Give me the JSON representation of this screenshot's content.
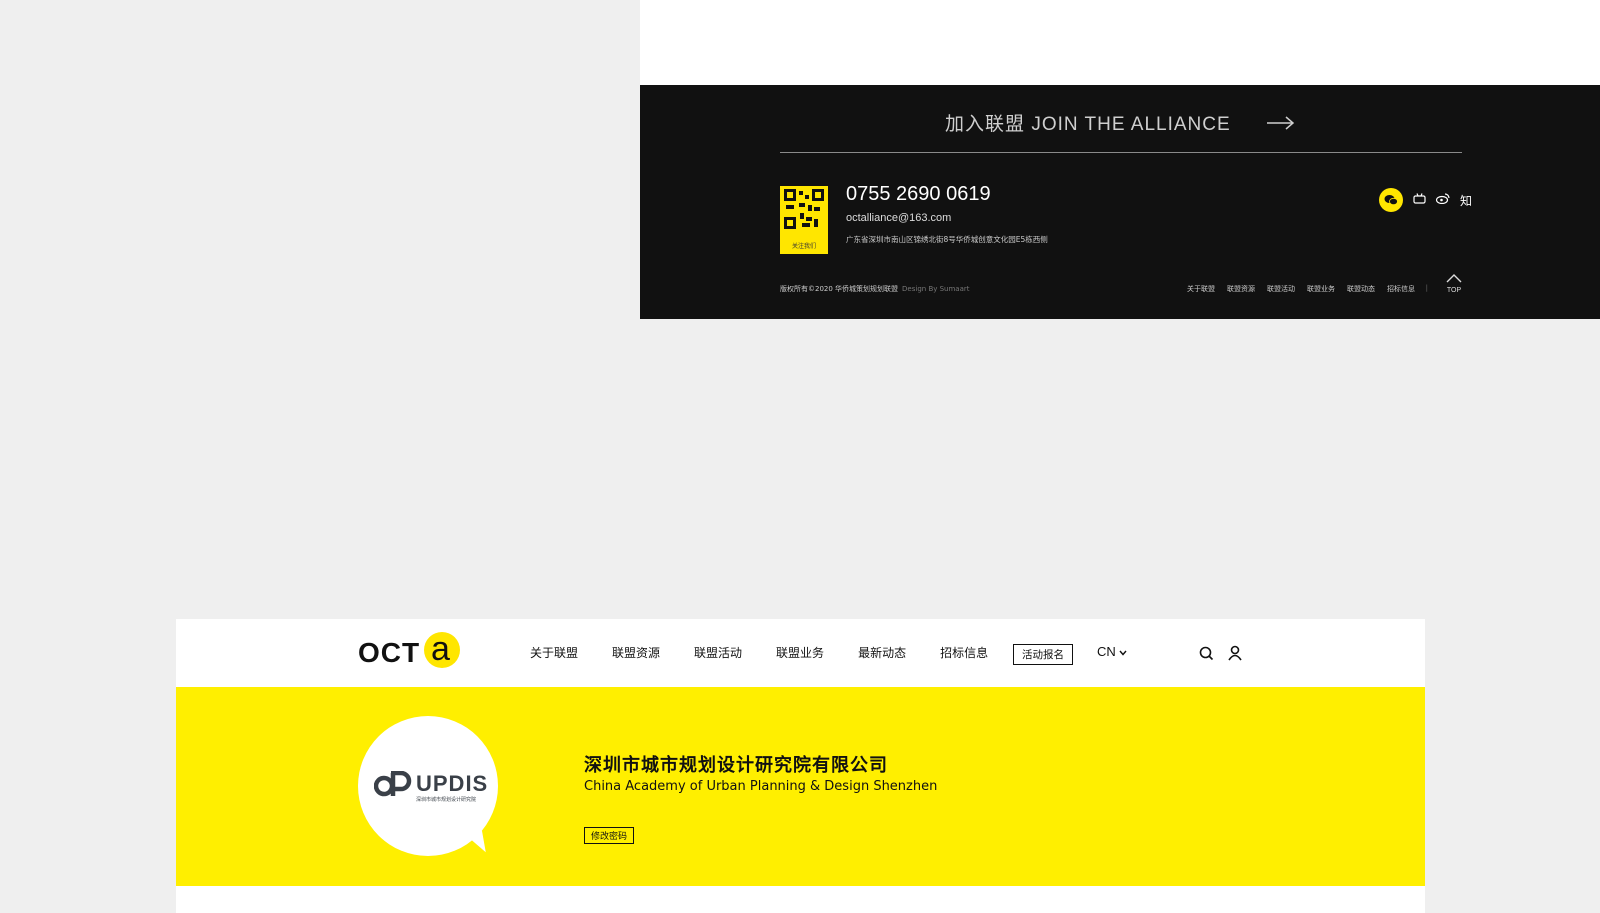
{
  "footer": {
    "join_text": "加入联盟 JOIN THE ALLIANCE",
    "qr_label": "关注我们",
    "phone": "0755 2690 0619",
    "email": "octalliance@163.com",
    "address": "广东省深圳市南山区锦绣北街8号华侨城创意文化园E5栋西侧",
    "copyright": "版权所有©2020 华侨城策划规划联盟",
    "design_credit": "Design By Sumaart",
    "nav": [
      "关于联盟",
      "联盟资源",
      "联盟活动",
      "联盟业务",
      "联盟动态",
      "招标信息"
    ],
    "separator": "|",
    "top_label": "TOP",
    "social_icons": [
      "wechat-icon",
      "bilibili-icon",
      "weibo-icon",
      "zhihu-icon"
    ],
    "zhihu_char": "知"
  },
  "header": {
    "logo_text": "OCT",
    "logo_letter": "a",
    "nav": [
      "关于联盟",
      "联盟资源",
      "联盟活动",
      "联盟业务",
      "最新动态",
      "招标信息"
    ],
    "signup": "活动报名",
    "lang": "CN"
  },
  "profile": {
    "logo_text": "UPDIS",
    "logo_sub": "深圳市城市规划设计研究院",
    "company_cn": "深圳市城市规划设计研究院有限公司",
    "company_en": "China Academy of Urban Planning & Design Shenzhen",
    "change_password": "修改密码"
  },
  "colors": {
    "accent": "#ffef00",
    "footer_bg": "#111111",
    "page_bg": "#efefef"
  }
}
